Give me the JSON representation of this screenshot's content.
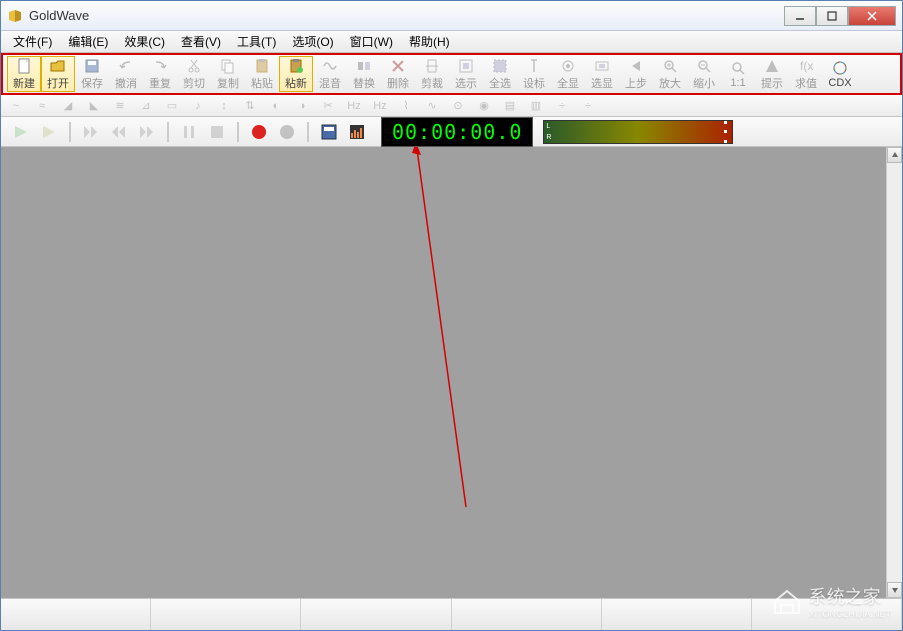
{
  "title": "GoldWave",
  "menu": [
    "文件(F)",
    "编辑(E)",
    "效果(C)",
    "查看(V)",
    "工具(T)",
    "选项(O)",
    "窗口(W)",
    "帮助(H)"
  ],
  "toolbar": [
    {
      "key": "new",
      "label": "新建",
      "active": true
    },
    {
      "key": "open",
      "label": "打开",
      "active": true
    },
    {
      "key": "save",
      "label": "保存",
      "disabled": true
    },
    {
      "key": "undo",
      "label": "撤消",
      "disabled": true
    },
    {
      "key": "redo",
      "label": "重复",
      "disabled": true
    },
    {
      "key": "cut",
      "label": "剪切",
      "disabled": true
    },
    {
      "key": "copy",
      "label": "复制",
      "disabled": true
    },
    {
      "key": "paste",
      "label": "粘贴",
      "disabled": true
    },
    {
      "key": "pastenew",
      "label": "粘新",
      "active": true
    },
    {
      "key": "mix",
      "label": "混音",
      "disabled": true
    },
    {
      "key": "replace",
      "label": "替换",
      "disabled": true
    },
    {
      "key": "delete",
      "label": "删除",
      "disabled": true
    },
    {
      "key": "trim",
      "label": "剪裁",
      "disabled": true
    },
    {
      "key": "selview",
      "label": "选示",
      "disabled": true
    },
    {
      "key": "selall",
      "label": "全选",
      "disabled": true
    },
    {
      "key": "marker",
      "label": "设标",
      "disabled": true
    },
    {
      "key": "showall",
      "label": "全显",
      "disabled": true
    },
    {
      "key": "selshow",
      "label": "选显",
      "disabled": true
    },
    {
      "key": "prev",
      "label": "上步",
      "disabled": true
    },
    {
      "key": "zoomin",
      "label": "放大",
      "disabled": true
    },
    {
      "key": "zoomout",
      "label": "缩小",
      "disabled": true
    },
    {
      "key": "zoom11",
      "label": "1:1",
      "disabled": true
    },
    {
      "key": "hint",
      "label": "提示",
      "disabled": true
    },
    {
      "key": "eval",
      "label": "求值",
      "disabled": true
    },
    {
      "key": "cdx",
      "label": "CDX",
      "disabled": false
    }
  ],
  "timer": "00:00:00.0",
  "meter": {
    "l": "L",
    "r": "R"
  },
  "watermark_text": "系统之家",
  "watermark_sub": "XITONGZHIJIA.NET"
}
